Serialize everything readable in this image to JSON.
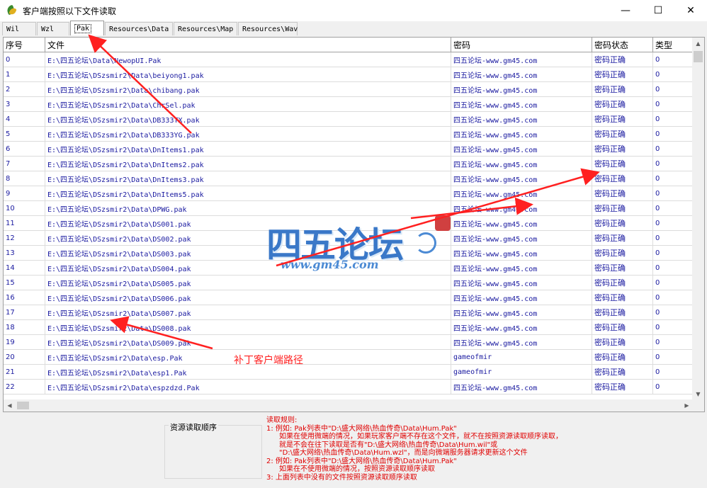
{
  "window": {
    "title": "客户端按照以下文件读取",
    "minimize": "—",
    "maximize": "☐",
    "close": "✕"
  },
  "tabs": [
    {
      "label": "Wil",
      "active": false
    },
    {
      "label": "Wzl",
      "active": false
    },
    {
      "label": "Pak",
      "active": true
    },
    {
      "label": "Resources\\Data",
      "active": false
    },
    {
      "label": "Resources\\Map",
      "active": false
    },
    {
      "label": "Resources\\Wav",
      "active": false
    }
  ],
  "table": {
    "headers": [
      "序号",
      "文件",
      "密码",
      "密码状态",
      "类型"
    ],
    "rows": [
      [
        "0",
        "E:\\四五论坛\\Data\\NewopUI.Pak",
        "四五论坛-www.gm45.com",
        "密码正确",
        "0"
      ],
      [
        "1",
        "E:\\四五论坛\\DSzsmir2\\Data\\beiyong1.pak",
        "四五论坛-www.gm45.com",
        "密码正确",
        "0"
      ],
      [
        "2",
        "E:\\四五论坛\\DSzsmir2\\Data\\chibang.pak",
        "四五论坛-www.gm45.com",
        "密码正确",
        "0"
      ],
      [
        "3",
        "E:\\四五论坛\\DSzsmir2\\Data\\ChrSel.pak",
        "四五论坛-www.gm45.com",
        "密码正确",
        "0"
      ],
      [
        "4",
        "E:\\四五论坛\\DSzsmir2\\Data\\DB333TX.pak",
        "四五论坛-www.gm45.com",
        "密码正确",
        "0"
      ],
      [
        "5",
        "E:\\四五论坛\\DSzsmir2\\Data\\DB333YG.pak",
        "四五论坛-www.gm45.com",
        "密码正确",
        "0"
      ],
      [
        "6",
        "E:\\四五论坛\\DSzsmir2\\Data\\DnItems1.pak",
        "四五论坛-www.gm45.com",
        "密码正确",
        "0"
      ],
      [
        "7",
        "E:\\四五论坛\\DSzsmir2\\Data\\DnItems2.pak",
        "四五论坛-www.gm45.com",
        "密码正确",
        "0"
      ],
      [
        "8",
        "E:\\四五论坛\\DSzsmir2\\Data\\DnItems3.pak",
        "四五论坛-www.gm45.com",
        "密码正确",
        "0"
      ],
      [
        "9",
        "E:\\四五论坛\\DSzsmir2\\Data\\DnItems5.pak",
        "四五论坛-www.gm45.com",
        "密码正确",
        "0"
      ],
      [
        "10",
        "E:\\四五论坛\\DSzsmir2\\Data\\DPWG.pak",
        "四五论坛-www.gm45.com",
        "密码正确",
        "0"
      ],
      [
        "11",
        "E:\\四五论坛\\DSzsmir2\\Data\\DS001.pak",
        "四五论坛-www.gm45.com",
        "密码正确",
        "0"
      ],
      [
        "12",
        "E:\\四五论坛\\DSzsmir2\\Data\\DS002.pak",
        "四五论坛-www.gm45.com",
        "密码正确",
        "0"
      ],
      [
        "13",
        "E:\\四五论坛\\DSzsmir2\\Data\\DS003.pak",
        "四五论坛-www.gm45.com",
        "密码正确",
        "0"
      ],
      [
        "14",
        "E:\\四五论坛\\DSzsmir2\\Data\\DS004.pak",
        "四五论坛-www.gm45.com",
        "密码正确",
        "0"
      ],
      [
        "15",
        "E:\\四五论坛\\DSzsmir2\\Data\\DS005.pak",
        "四五论坛-www.gm45.com",
        "密码正确",
        "0"
      ],
      [
        "16",
        "E:\\四五论坛\\DSzsmir2\\Data\\DS006.pak",
        "四五论坛-www.gm45.com",
        "密码正确",
        "0"
      ],
      [
        "17",
        "E:\\四五论坛\\DSzsmir2\\Data\\DS007.pak",
        "四五论坛-www.gm45.com",
        "密码正确",
        "0"
      ],
      [
        "18",
        "E:\\四五论坛\\DSzsmir2\\Data\\DS008.pak",
        "四五论坛-www.gm45.com",
        "密码正确",
        "0"
      ],
      [
        "19",
        "E:\\四五论坛\\DSzsmir2\\Data\\DS009.pak",
        "四五论坛-www.gm45.com",
        "密码正确",
        "0"
      ],
      [
        "20",
        "E:\\四五论坛\\DSzsmir2\\Data\\esp.Pak",
        "gameofmir",
        "密码正确",
        "0"
      ],
      [
        "21",
        "E:\\四五论坛\\DSzsmir2\\Data\\esp1.Pak",
        "gameofmir",
        "密码正确",
        "0"
      ],
      [
        "22",
        "E:\\四五论坛\\DSzsmir2\\Data\\espzdzd.Pak",
        "四五论坛-www.gm45.com",
        "密码正确",
        "0"
      ]
    ]
  },
  "scroll": {
    "up": "▲",
    "down": "▼",
    "left": "◀",
    "right": "▶"
  },
  "order_panel": {
    "label": "资源读取顺序"
  },
  "rules": {
    "title": "读取规则:",
    "lines": [
      {
        "text": "1: 例如: Pak列表中\"D:\\盛大网络\\热血传奇\\Data\\Hum.Pak\"",
        "indent": false
      },
      {
        "text": "如果在使用微端的情况，如果玩家客户端不存在这个文件，就不在按照资源读取顺序读取，",
        "indent": true
      },
      {
        "text": "就是不会在往下读取是否有\"D:\\盛大网络\\热血传奇\\Data\\Hum.wil\"或",
        "indent": true
      },
      {
        "text": "\"D:\\盛大网络\\热血传奇\\Data\\Hum.wzl\"，而是向微端服务器请求更新这个文件",
        "indent": true
      },
      {
        "text": "2: 例如: Pak列表中\"D:\\盛大网络\\热血传奇\\Data\\Hum.Pak\"",
        "indent": false
      },
      {
        "text": "如果在不使用微端的情况，按照资源读取顺序读取",
        "indent": true
      },
      {
        "text": "3: 上面列表中没有的文件按照资源读取顺序读取",
        "indent": false
      }
    ]
  },
  "annotation": {
    "label": "补丁客户端路径",
    "color": "#ff2020"
  },
  "watermark": {
    "title": "四五论坛",
    "url": "www.gm45.com"
  }
}
